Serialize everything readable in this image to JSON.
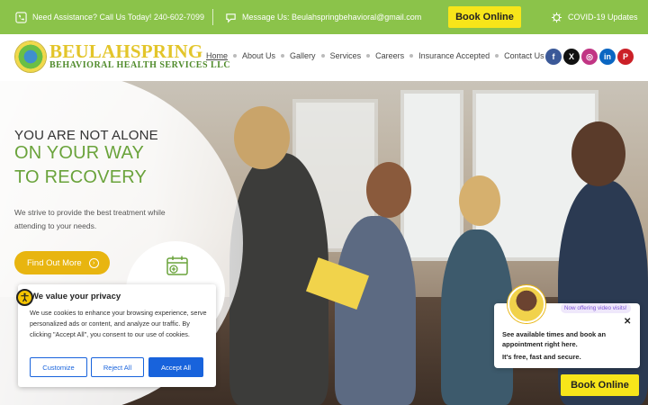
{
  "topbar": {
    "assistance": "Need Assistance? Call Us Today! 240-602-7099",
    "message": "Message Us: Beulahspringbehavioral@gmail.com",
    "book_label": "Book Online",
    "covid": "COVID-19 Updates",
    "bg_color": "#8bc34a"
  },
  "header": {
    "logo_title": "BEULAHSPRING",
    "logo_sub": "BEHAVIORAL HEALTH SERVICES LLC",
    "nav": [
      "Home",
      "About Us",
      "Gallery",
      "Services",
      "Careers",
      "Insurance Accepted",
      "Contact Us"
    ],
    "active_nav": "Home",
    "social": [
      {
        "name": "facebook-icon",
        "glyph": "f",
        "color": "#3b5998"
      },
      {
        "name": "x-twitter-icon",
        "glyph": "X",
        "color": "#111111"
      },
      {
        "name": "instagram-icon",
        "glyph": "◎",
        "color": "#c13584"
      },
      {
        "name": "linkedin-icon",
        "glyph": "in",
        "color": "#0a66c2"
      },
      {
        "name": "pinterest-icon",
        "glyph": "P",
        "color": "#cb2027"
      }
    ]
  },
  "hero": {
    "line1": "YOU ARE NOT ALONE",
    "line2": "ON YOUR WAY",
    "line3": "TO RECOVERY",
    "description": "We strive to provide the best treatment while attending to your needs.",
    "cta_label": "Find Out More",
    "accent_color": "#6aa33b",
    "cta_color": "#e8b510"
  },
  "cookie": {
    "title": "We value your privacy",
    "text": "We use cookies to enhance your browsing experience, serve personalized ads or content, and analyze our traffic. By clicking \"Accept All\", you consent to our use of cookies.",
    "customize": "Customize",
    "reject": "Reject All",
    "accept": "Accept All",
    "button_color": "#1863dc"
  },
  "chat": {
    "pill": "Now offering video visits!",
    "close": "✕",
    "text": "See available times and book an appointment right here.",
    "sub": "It's free, fast and secure.",
    "book_label": "Book Online"
  }
}
